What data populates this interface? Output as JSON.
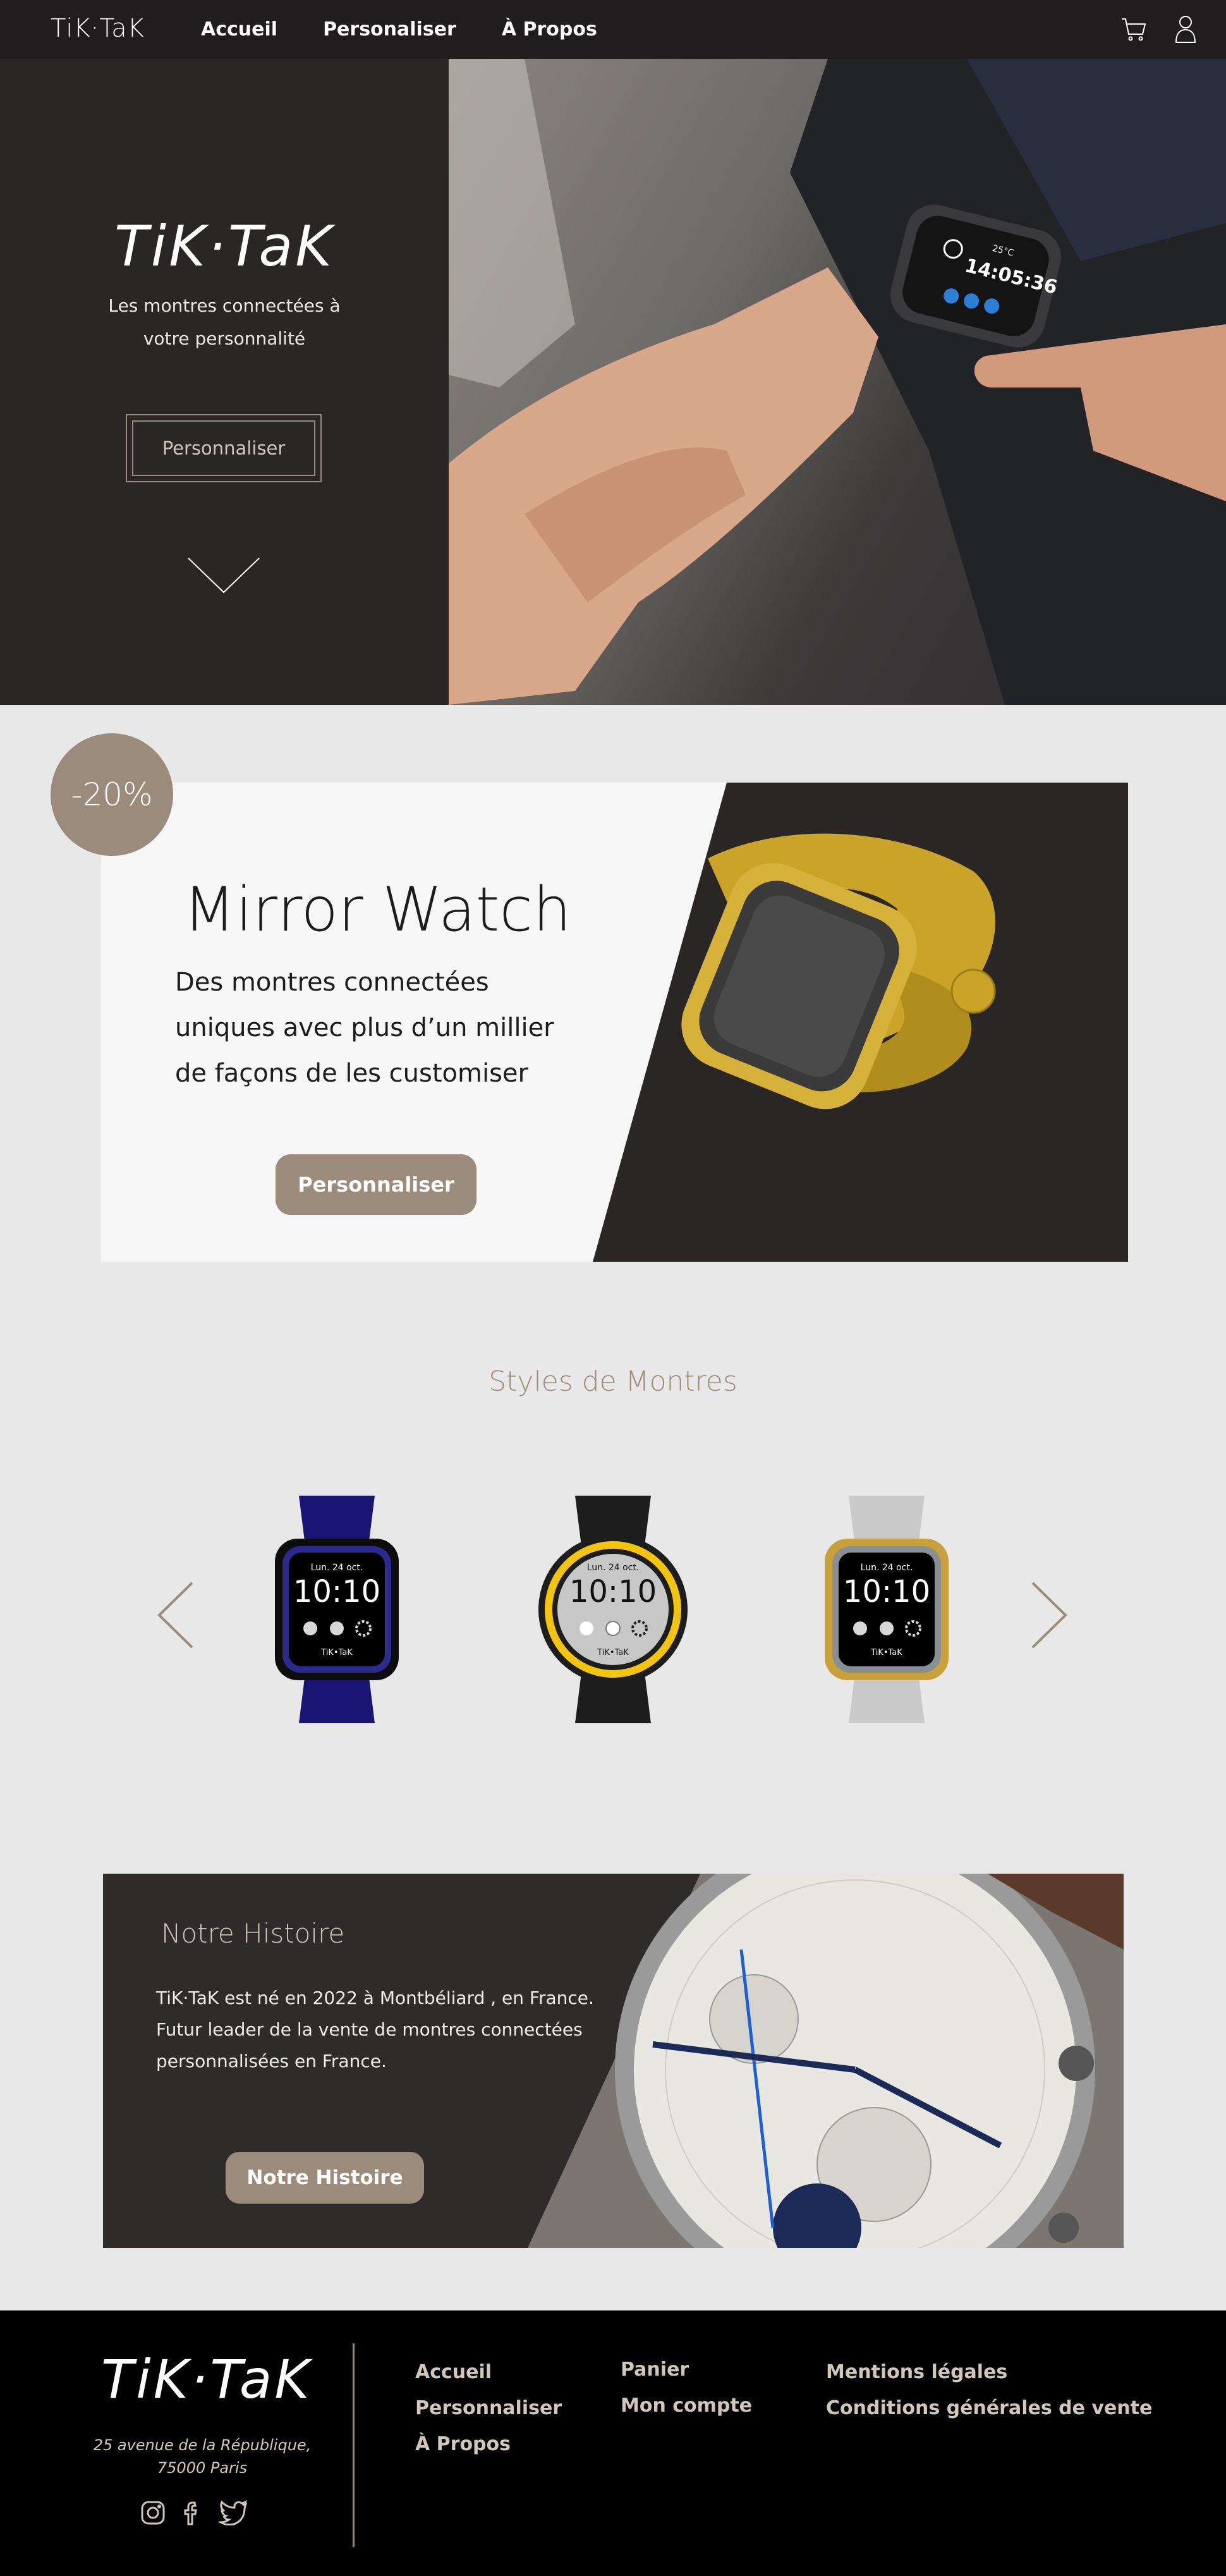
{
  "nav": {
    "logo": "TiK·TaK",
    "links": [
      "Accueil",
      "Personaliser",
      "À Propos"
    ],
    "icons": [
      "cart-icon",
      "user-icon"
    ]
  },
  "hero": {
    "title": "TiK·TaK",
    "subtitle": "Les montres connectées à votre personnalité",
    "button": "Personnaliser",
    "watch_display": {
      "temp": "25°C",
      "time": "14:05:36"
    }
  },
  "promo": {
    "badge": "-20%",
    "title": "Mirror Watch",
    "text": "Des montres connectées uniques avec plus d’un millier de façons de les customiser",
    "button": "Personnaliser"
  },
  "styles": {
    "title": "Styles de Montres",
    "watches": [
      {
        "date": "Lun. 24 oct.",
        "time": "10:10",
        "brand": "TiK•TaK",
        "band": "#1a1575",
        "bezel": "#2c2a8f"
      },
      {
        "date": "Lun. 24 oct.",
        "time": "10:10",
        "brand": "TiK•TaK",
        "band": "#1d1d1d",
        "bezel": "#f2c40e"
      },
      {
        "date": "Lun. 24 oct.",
        "time": "10:10",
        "brand": "TiK•TaK",
        "band": "#c9c9c9",
        "bezel": "#c9a13a"
      }
    ]
  },
  "history": {
    "title": "Notre Histoire",
    "text": "TiK·TaK est né en 2022 à Montbéliard , en France. Futur leader de la vente de montres connectées personnalisées en France.",
    "button": "Notre Histoire"
  },
  "footer": {
    "logo": "TiK·TaK",
    "address_line1": "25 avenue de la République,",
    "address_line2": "75000 Paris",
    "social": [
      "instagram-icon",
      "facebook-icon",
      "twitter-icon"
    ],
    "col1": [
      "Accueil",
      "Personnaliser",
      "À Propos"
    ],
    "col2": [
      "Panier",
      "Mon compte"
    ],
    "col3": [
      "Mentions légales",
      "Conditions générales de vente"
    ]
  },
  "colors": {
    "accent": "#9b8b7a",
    "dark": "#2a2625",
    "nav": "#1f1d1d"
  }
}
